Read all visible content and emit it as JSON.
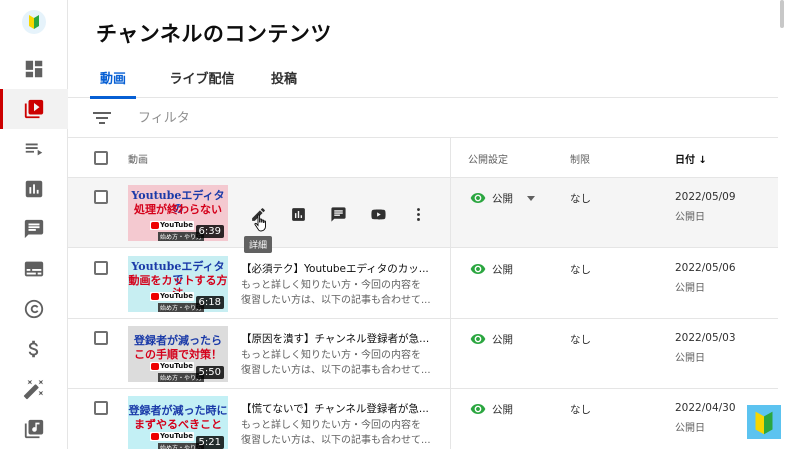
{
  "page": {
    "title": "チャンネルのコンテンツ"
  },
  "tabs": [
    {
      "label": "動画",
      "active": true
    },
    {
      "label": "ライブ配信",
      "active": false
    },
    {
      "label": "投稿",
      "active": false
    }
  ],
  "filter": {
    "placeholder": "フィルタ"
  },
  "columns": {
    "video": "動画",
    "visibility": "公開設定",
    "restrictions": "制限",
    "date": "日付 ↓"
  },
  "tooltip": "詳細",
  "videos": [
    {
      "thumb_line1": "Youtubeエディタの",
      "thumb_line2": "処理が終わらない",
      "thumb_bg": "#f4c9d0",
      "duration": "6:39",
      "title": "",
      "desc1": "",
      "desc2": "",
      "visibility": "公開",
      "restrictions": "なし",
      "date": "2022/05/09",
      "date_sub": "公開日"
    },
    {
      "thumb_line1": "Youtubeエディタで",
      "thumb_line2": "動画をカットする方法",
      "thumb_bg": "#c7eef2",
      "duration": "6:18",
      "title": "【必須テク】Youtubeエディタのカッ...",
      "desc1": "もっと詳しく知りたい方・今回の内容を",
      "desc2": "復習したい方は、以下の記事も合わせて...",
      "visibility": "公開",
      "restrictions": "なし",
      "date": "2022/05/06",
      "date_sub": "公開日"
    },
    {
      "thumb_line1": "登録者が減ったら",
      "thumb_line2": "この手順で対策！",
      "thumb_bg": "#dcdcdc",
      "duration": "5:50",
      "title": "【原因を潰す】チャンネル登録者が急...",
      "desc1": "もっと詳しく知りたい方・今回の内容を",
      "desc2": "復習したい方は、以下の記事も合わせて...",
      "visibility": "公開",
      "restrictions": "なし",
      "date": "2022/05/03",
      "date_sub": "公開日"
    },
    {
      "thumb_line1": "登録者が減った時に",
      "thumb_line2": "まずやるべきこと",
      "thumb_bg": "#c3f0f5",
      "duration": "5:21",
      "title": "【慌てないで】チャンネル登録者が急...",
      "desc1": "もっと詳しく知りたい方・今回の内容を",
      "desc2": "復習したい方は、以下の記事も合わせて...",
      "visibility": "公開",
      "restrictions": "なし",
      "date": "2022/04/30",
      "date_sub": "公開日"
    }
  ],
  "thumb_common": {
    "brand": "YouTube",
    "sub": "始め方・やり方"
  },
  "colors": {
    "accent": "#065fd4",
    "active_rail": "#cc0000",
    "public_icon": "#2ba640"
  }
}
